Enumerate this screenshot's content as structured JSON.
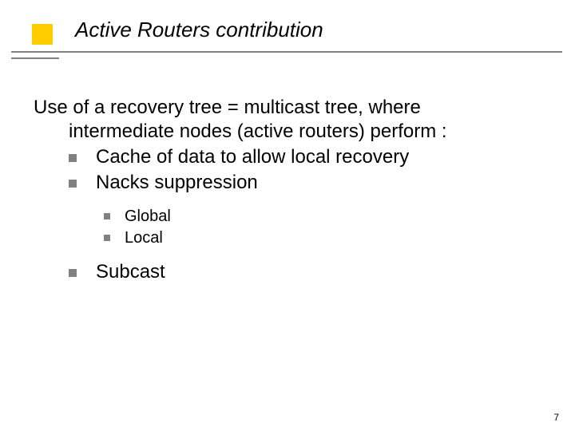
{
  "title": "Active Routers contribution",
  "intro": "Use of a recovery tree = multicast tree, where intermediate nodes (active routers) perform :",
  "level1": {
    "item1": "Cache of data to  allow local recovery",
    "item2": "Nacks suppression",
    "item3": "Subcast"
  },
  "level2": {
    "item1": "Global",
    "item2": "Local"
  },
  "page_number": "7"
}
